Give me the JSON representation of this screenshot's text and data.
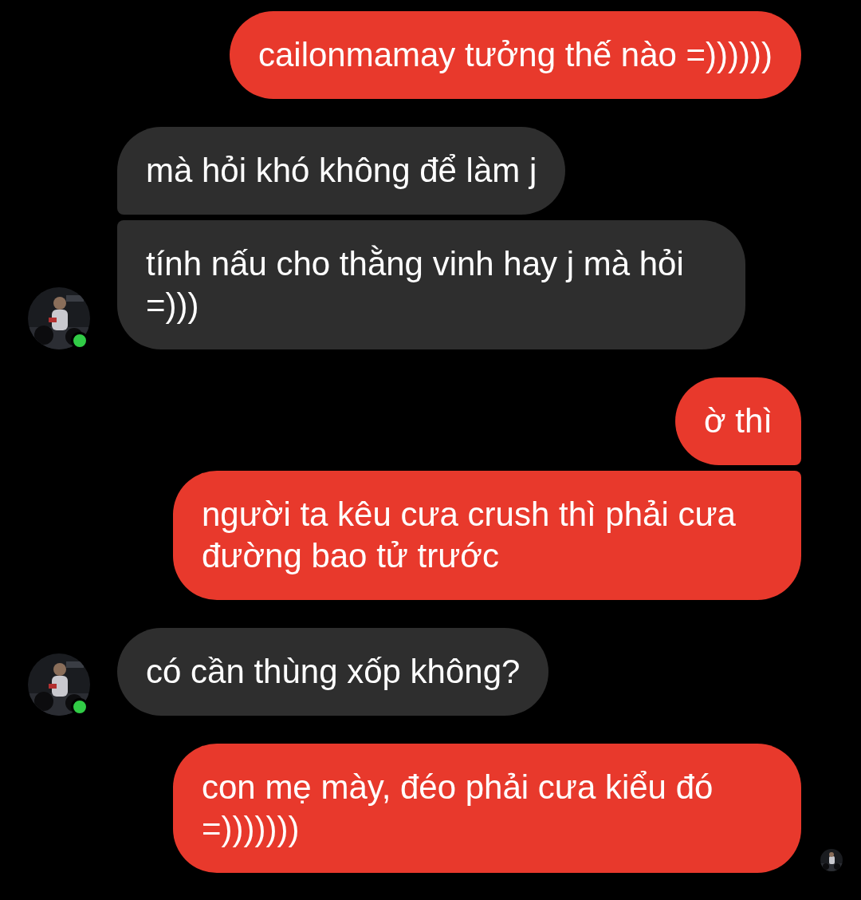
{
  "contact": {
    "online": true
  },
  "messages": [
    {
      "outgoing": true,
      "text": "cailonmamay tưởng thế nào =))))))"
    },
    {
      "outgoing": false,
      "text": "mà hỏi khó không để làm j"
    },
    {
      "outgoing": false,
      "text": "tính nấu cho thằng vinh hay j mà hỏi =)))"
    },
    {
      "outgoing": true,
      "text": "ờ thì"
    },
    {
      "outgoing": true,
      "text": "người ta kêu cưa crush thì phải cưa đường bao tử trước"
    },
    {
      "outgoing": false,
      "text": "có cần thùng xốp không?"
    },
    {
      "outgoing": true,
      "text": "con mẹ mày, đéo phải cưa kiểu đó =)))))))",
      "seen": true
    }
  ]
}
